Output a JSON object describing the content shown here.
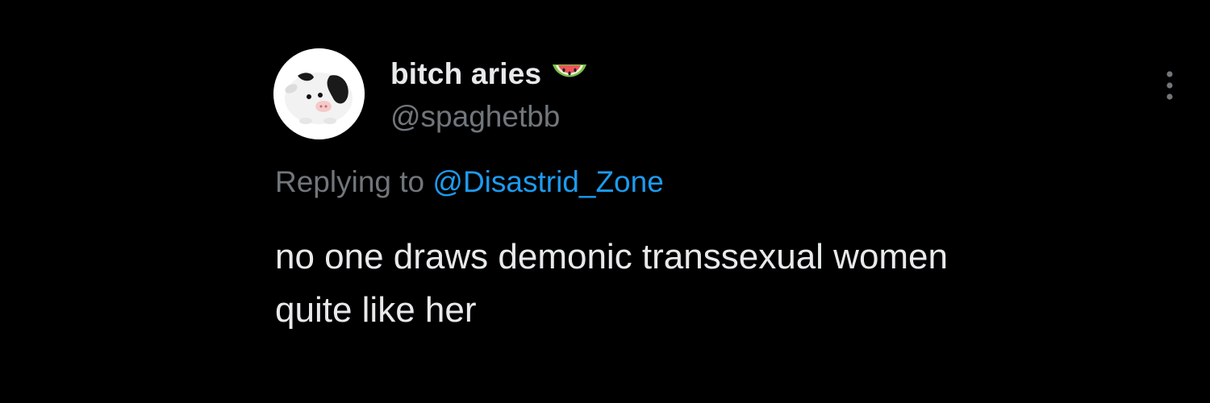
{
  "tweet": {
    "author": {
      "display_name": "bitch aries",
      "handle": "@spaghetbb",
      "avatar_icon": "cow-plush-avatar",
      "name_badge_icon": "watermelon-icon"
    },
    "reply": {
      "prefix": "Replying to",
      "mention": "@Disastrid_Zone"
    },
    "text_lines": [
      "no one draws demonic transsexual women",
      "quite like her"
    ],
    "more_icon": "more-vertical-icon"
  },
  "colors": {
    "background": "#000000",
    "primary_text": "#e7e9ea",
    "secondary_text": "#71767b",
    "link": "#1d9bf0"
  }
}
